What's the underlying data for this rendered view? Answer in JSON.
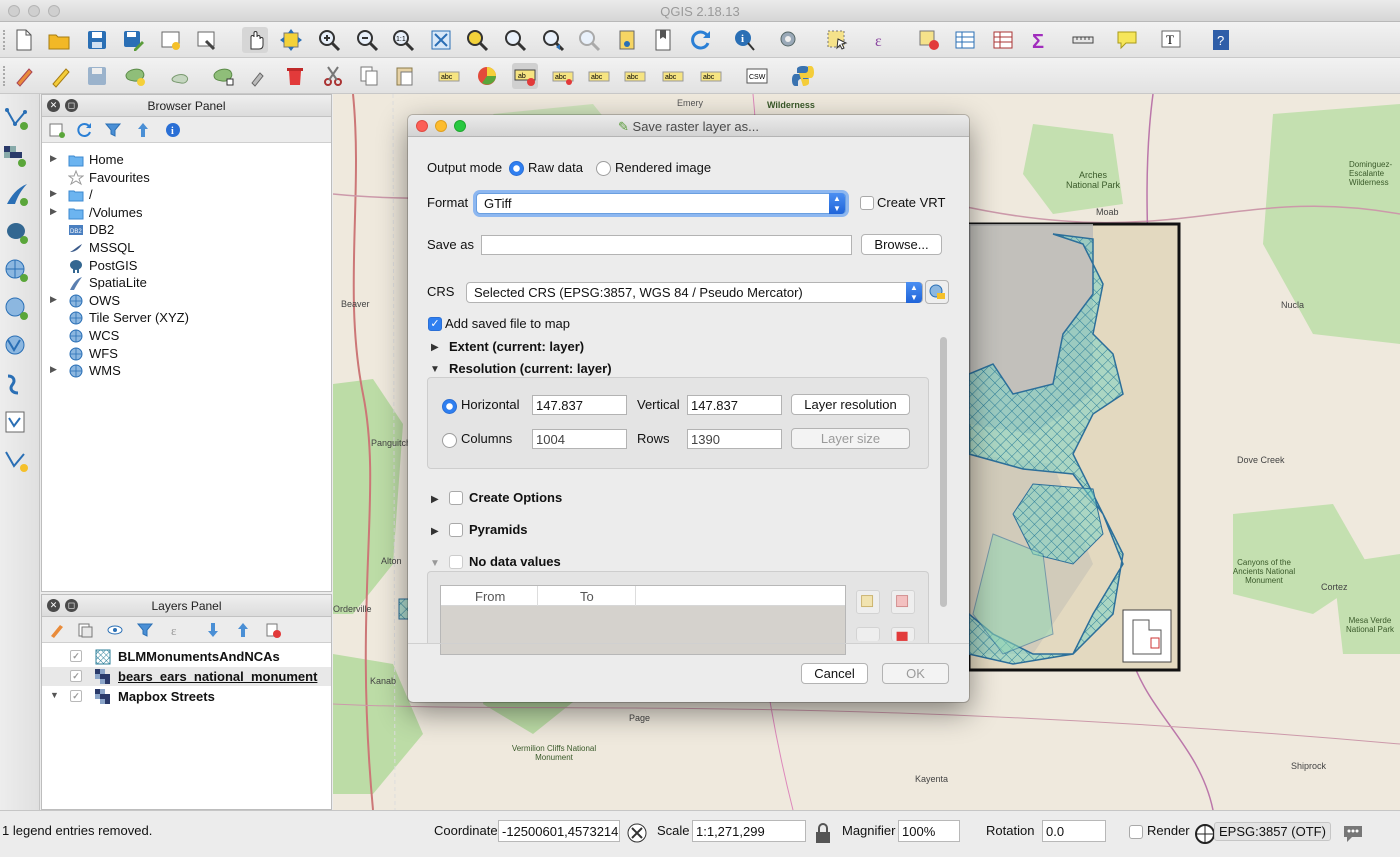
{
  "window": {
    "title": "QGIS 2.18.13"
  },
  "browser_panel": {
    "title": "Browser Panel",
    "items": [
      {
        "label": "Home",
        "expandable": true,
        "icon": "folder-icon"
      },
      {
        "label": "Favourites",
        "expandable": false,
        "icon": "star-icon"
      },
      {
        "label": "/",
        "expandable": true,
        "icon": "folder-icon"
      },
      {
        "label": "/Volumes",
        "expandable": true,
        "icon": "folder-icon"
      },
      {
        "label": "DB2",
        "expandable": false,
        "icon": "db2-icon"
      },
      {
        "label": "MSSQL",
        "expandable": false,
        "icon": "mssql-icon"
      },
      {
        "label": "PostGIS",
        "expandable": false,
        "icon": "postgis-elephant-icon"
      },
      {
        "label": "SpatiaLite",
        "expandable": false,
        "icon": "spatialite-feather-icon"
      },
      {
        "label": "OWS",
        "expandable": true,
        "icon": "globe-icon"
      },
      {
        "label": "Tile Server (XYZ)",
        "expandable": false,
        "icon": "globe-icon"
      },
      {
        "label": "WCS",
        "expandable": false,
        "icon": "globe-icon"
      },
      {
        "label": "WFS",
        "expandable": false,
        "icon": "globe-icon"
      },
      {
        "label": "WMS",
        "expandable": true,
        "icon": "globe-icon"
      }
    ]
  },
  "layers_panel": {
    "title": "Layers Panel",
    "layers": [
      {
        "label": "BLMMonumentsAndNCAs",
        "checked": true,
        "selected": false,
        "icon": "polygon-layer-icon"
      },
      {
        "label": "bears_ears_national_monument",
        "checked": true,
        "selected": true,
        "icon": "raster-layer-icon"
      },
      {
        "label": "Mapbox Streets",
        "checked": true,
        "selected": false,
        "icon": "raster-layer-icon"
      }
    ]
  },
  "map_labels": [
    {
      "text": "Emery"
    },
    {
      "text": "Wilderness"
    },
    {
      "text": "Arches National Park"
    },
    {
      "text": "Moab"
    },
    {
      "text": "Dominguez-Escalante Wilderness"
    },
    {
      "text": "Beaver"
    },
    {
      "text": "Panguitch"
    },
    {
      "text": "Orderville"
    },
    {
      "text": "Alton"
    },
    {
      "text": "Kanab"
    },
    {
      "text": "Page"
    },
    {
      "text": "Vermilion Cliffs National Monument"
    },
    {
      "text": "Kayenta"
    },
    {
      "text": "Shiprock"
    },
    {
      "text": "Nucla"
    },
    {
      "text": "Dove Creek"
    },
    {
      "text": "Canyons of the Ancients National Monument"
    },
    {
      "text": "Cortez"
    },
    {
      "text": "Mesa Verde National Park"
    }
  ],
  "dialog": {
    "title": "Save raster layer as...",
    "output_mode_label": "Output mode",
    "raw_data_label": "Raw data",
    "rendered_image_label": "Rendered image",
    "output_mode_selected": "Raw data",
    "format_label": "Format",
    "format_value": "GTiff",
    "create_vrt_label": "Create VRT",
    "create_vrt_checked": false,
    "save_as_label": "Save as",
    "save_as_value": "",
    "browse_label": "Browse...",
    "crs_label": "CRS",
    "crs_value": "Selected CRS (EPSG:3857, WGS 84 / Pseudo Mercator)",
    "add_to_map_label": "Add saved file to map",
    "add_to_map_checked": true,
    "extent_label": "Extent (current: layer)",
    "resolution_label": "Resolution (current: layer)",
    "horizontal_label": "Horizontal",
    "horizontal_value": "147.837",
    "vertical_label": "Vertical",
    "vertical_value": "147.837",
    "layer_resolution_label": "Layer resolution",
    "columns_label": "Columns",
    "columns_value": "1004",
    "rows_label": "Rows",
    "rows_value": "1390",
    "layer_size_label": "Layer size",
    "resolution_mode_selected": "Horizontal",
    "create_options_label": "Create Options",
    "pyramids_label": "Pyramids",
    "no_data_label": "No data values",
    "nodata_columns": [
      "From",
      "To"
    ],
    "cancel_label": "Cancel",
    "ok_label": "OK"
  },
  "status_bar": {
    "message": "1 legend entries removed.",
    "coordinate_label": "Coordinate",
    "coordinate_value": "-12500601,4573214",
    "scale_label": "Scale",
    "scale_value": "1:1,271,299",
    "magnifier_label": "Magnifier",
    "magnifier_value": "100%",
    "rotation_label": "Rotation",
    "rotation_value": "0.0",
    "render_label": "Render",
    "render_checked": false,
    "crs_value": "EPSG:3857 (OTF)"
  },
  "colors": {
    "accent": "#2f7ff0",
    "map_background": "#efe9dd",
    "park_green": "#b8d9a3",
    "hatch_cyan": "#49c9d6",
    "road": "#b04a5a"
  }
}
